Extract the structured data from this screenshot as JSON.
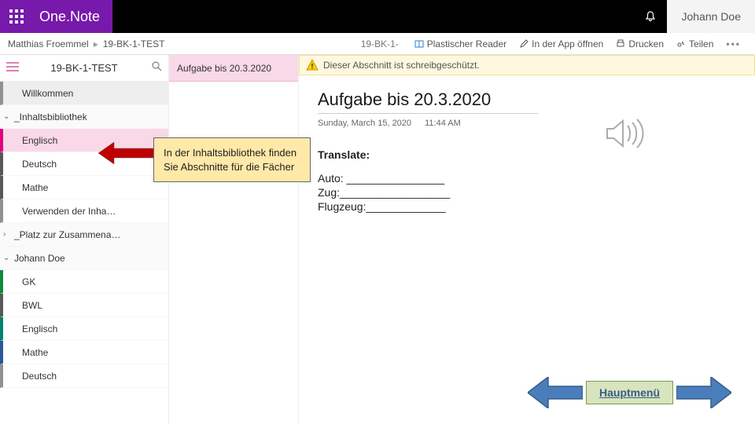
{
  "header": {
    "brand": "One.Note",
    "user": "Johann Doe"
  },
  "toolbar": {
    "crumb_owner": "Matthias Froemmel",
    "crumb_notebook": "19-BK-1-TEST",
    "crumb_short": "19-BK-1-",
    "immersive": "Plastischer Reader",
    "open_app": "In der App öffnen",
    "print": "Drucken",
    "share": "Teilen"
  },
  "notebook": {
    "title": "19-BK-1-TEST",
    "welcome": "Willkommen",
    "groups": {
      "library": "_Inhaltsbibliothek",
      "collab": "_Platz zur Zusammena…",
      "student": "Johann Doe"
    },
    "lib_sections": [
      "Englisch",
      "Deutsch",
      "Mathe",
      "Verwenden der Inha…"
    ],
    "student_sections": [
      "GK",
      "BWL",
      "Englisch",
      "Mathe",
      "Deutsch"
    ]
  },
  "pages": {
    "current": "Aufgabe bis 20.3.2020"
  },
  "alert": {
    "text": "Dieser Abschnitt ist schreibgeschützt."
  },
  "page": {
    "title": "Aufgabe bis 20.3.2020",
    "date": "Sunday, March 15, 2020",
    "time": "11:44 AM",
    "trans_label": "Translate:",
    "lines": [
      "Auto: ________________",
      "Zug:__________________",
      "Flugzeug:_____________"
    ]
  },
  "callout": {
    "text": "In der Inhaltsbibliothek finden Sie Abschnitte für die Fächer"
  },
  "nav": {
    "main": "Hauptmenü"
  },
  "colors": {
    "arrow_fill": "#4a7ebb",
    "arrow_stroke": "#385d8a",
    "callout_arrow": "#c00000"
  }
}
